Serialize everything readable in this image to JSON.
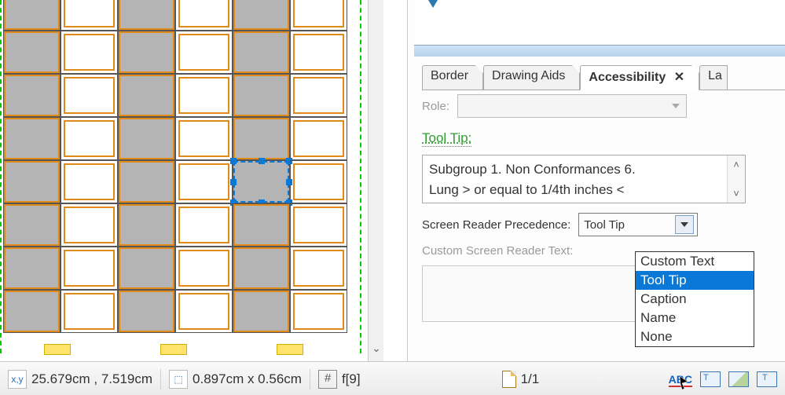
{
  "tabs": {
    "border": "Border",
    "drawing_aids": "Drawing Aids",
    "accessibility": "Accessibility",
    "layout_cut": "La"
  },
  "panel": {
    "role_label": "Role:",
    "tooltip_label": "Tool Tip:",
    "tooltip_line1": "Subgroup 1. Non Conformances  6.",
    "tooltip_line2": "Lung  > or equal to 1/4th inches  <",
    "precedence_label": "Screen Reader Precedence:",
    "precedence_value": "Tool Tip",
    "custom_text_label": "Custom Screen Reader Text:"
  },
  "dropdown_options": {
    "o0": "Custom Text",
    "o1": "Tool Tip",
    "o2": "Caption",
    "o3": "Name",
    "o4": "None"
  },
  "statusbar": {
    "coords": "25.679cm , 7.519cm",
    "size": "0.897cm x 0.56cm",
    "field": "f[9]",
    "page": "1/1"
  },
  "icons": {
    "xy": "xy-position-icon",
    "wh": "object-size-icon",
    "hash": "field-ref-icon",
    "page": "page-icon",
    "abc": "spellcheck-icon",
    "text_field": "text-field-tool-icon",
    "image_tool": "image-tool-icon",
    "anchor": "anchor-tool-icon"
  }
}
